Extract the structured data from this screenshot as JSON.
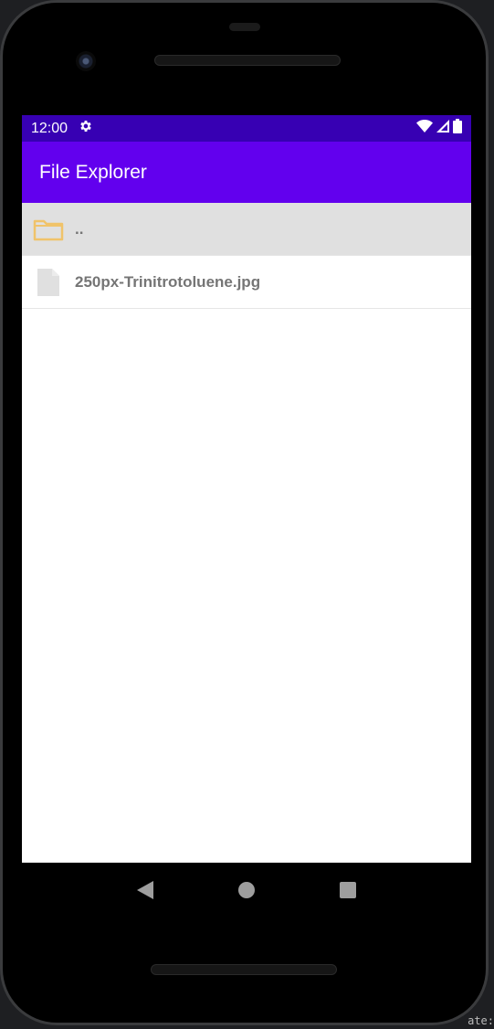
{
  "status_bar": {
    "time": "12:00",
    "icons": [
      "settings-gear-icon",
      "wifi-icon",
      "cell-signal-icon",
      "battery-icon"
    ],
    "bg_color": "#3700b3"
  },
  "app_bar": {
    "title": "File Explorer",
    "bg_color": "#6200ee"
  },
  "file_list": {
    "items": [
      {
        "icon": "folder-icon",
        "label": "..",
        "selected": true
      },
      {
        "icon": "file-icon",
        "label": "250px-Trinitrotoluene.jpg",
        "selected": false
      }
    ]
  },
  "nav_bar": {
    "buttons": [
      "back-icon",
      "home-icon",
      "recents-icon"
    ]
  },
  "corner_text": "ate:"
}
